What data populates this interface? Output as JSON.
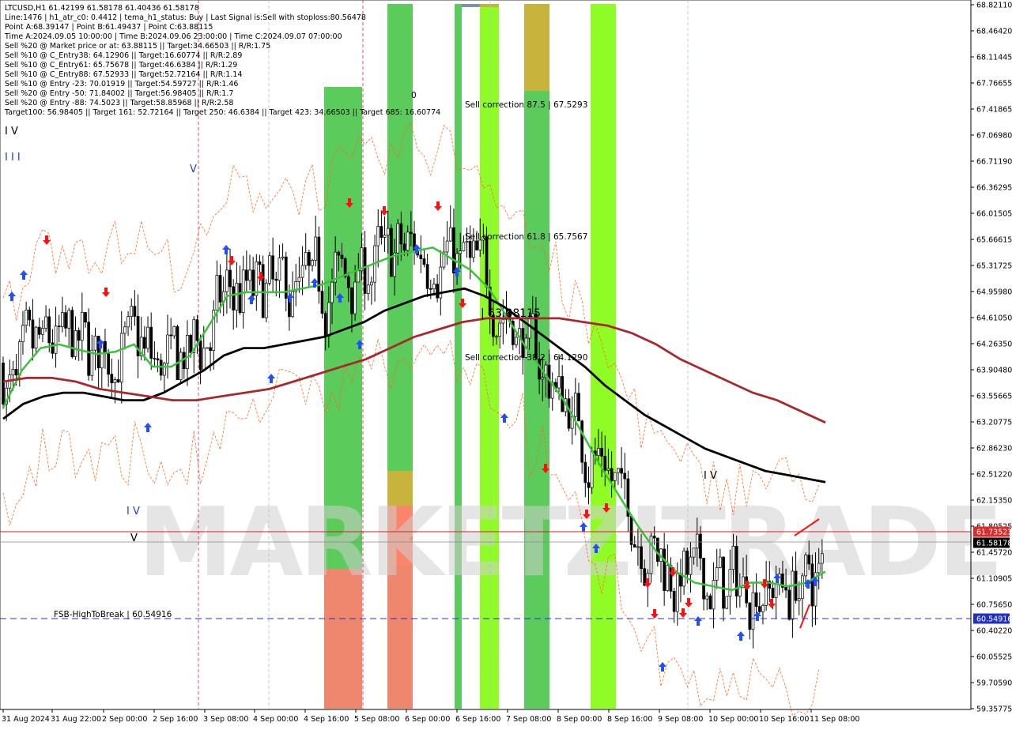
{
  "header": {
    "lines": [
      "LTCUSD,H1  61.42199 61.58178 61.40436 61.58178",
      "Line:1476  |  h1_atr_c0: 0.4412  |  tema_h1_status: Buy  |  Last Signal is:Sell with stoploss:80.56478",
      "Point A:68.39147  |  Point B:61.49437  |  Point C:63.88115",
      "Time A:2024.09.05 10:00:00  |  Time B:2024.09.06 23:00:00  |  Time C:2024.09.07 07:00:00",
      "Sell %20 @ Market price or at: 63.88115  ||  Target:34.66503  ||  R/R:1.75",
      "Sell %10 @ C_Entry38: 64.12906  ||  Target:16.60774  ||  R/R:2.89",
      "Sell %10 @ C_Entry61: 65.75678  ||  Target:46.6384  ||  R/R:1.29",
      "Sell %10 @ C_Entry88: 67.52933  ||  Target:52.72164  ||  R/R:1.14",
      "Sell %10 @ Entry -23: 70.01919  ||  Target:54.59727  ||  R/R:1.46",
      "Sell %20 @ Entry -50: 71.84002  ||  Target:56.98405  ||  R/R:1.7",
      "Sell %20 @ Entry -88: 74.5023  ||  Target:58.85968  ||  R/R:2.58",
      "Target100: 56.98405  ||  Target 161: 52.72164  ||  Target 250: 46.6384  ||  Target 423: 34.66503  ||  Target 685: 16.60774"
    ]
  },
  "waves": {
    "w_iv_top": "I V",
    "w_iii": "I I I",
    "w_v_mid": "V",
    "w_iv_left": "I V",
    "w_v_left": "V",
    "w_iv_right": "I V"
  },
  "annotations": {
    "sell87": "Sell correction 87.5 | 67.5293",
    "sell61": "Sell correction 61.8 | 65.7567",
    "sell38": "Sell correction 38.2 | 64.1290",
    "pointC": "| 63.88115",
    "fsb": "FSB-HighToBreak  |  60.54916",
    "zero": "0"
  },
  "watermark": "MARKETZITRADE",
  "colors": {
    "green_zone": "#3ec23e",
    "lime_zone": "#7cfc00",
    "olive_zone": "#c8b43c",
    "salmon_zone": "#ff8070",
    "ma_green": "#39c439",
    "ma_black": "#000000",
    "ma_red": "#a8282c",
    "bull_arrow": "#1f4fff",
    "bear_arrow": "#ff1010",
    "fsb_line": "#2030c0",
    "red_level": "#d02020"
  },
  "chart_data": {
    "type": "candlestick",
    "symbol": "LTCUSD",
    "timeframe": "H1",
    "ohlc_last": {
      "open": 61.42199,
      "high": 61.58178,
      "low": 61.40436,
      "close": 61.58178
    },
    "y_ticks": [
      "68.82110",
      "68.46420",
      "68.11445",
      "67.76655",
      "67.41865",
      "67.06980",
      "66.71190",
      "66.36295",
      "66.01505",
      "65.66615",
      "65.31725",
      "64.95980",
      "64.61050",
      "64.26350",
      "63.90480",
      "63.55665",
      "63.20775",
      "62.86230",
      "62.51220",
      "62.15350",
      "61.80525",
      "61.45720",
      "61.10905",
      "60.75650",
      "60.40220",
      "60.05525",
      "59.70590",
      "59.35775"
    ],
    "x_ticks": [
      "31 Aug 2024",
      "31 Aug 22:00",
      "2 Sep 00:00",
      "2 Sep 16:00",
      "3 Sep 08:00",
      "4 Sep 00:00",
      "4 Sep 16:00",
      "5 Sep 08:00",
      "6 Sep 00:00",
      "6 Sep 16:00",
      "7 Sep 08:00",
      "8 Sep 00:00",
      "8 Sep 16:00",
      "9 Sep 08:00",
      "10 Sep 00:00",
      "10 Sep 16:00",
      "11 Sep 08:00"
    ],
    "price_tags": [
      {
        "label": "61.73523",
        "value": 61.73523,
        "color": "#e02828"
      },
      {
        "label": "61.58178",
        "value": 61.58178,
        "color": "#000000"
      },
      {
        "label": "60.54916",
        "value": 60.54916,
        "color": "#2030c0"
      }
    ],
    "ylim": [
      59.35775,
      68.8211
    ],
    "zones": [
      {
        "x0": 0.0,
        "x1": 0.045,
        "color": "green"
      },
      {
        "x0": 0.158,
        "x1": 0.188,
        "color": "green"
      },
      {
        "x0": 0.196,
        "x1": 0.213,
        "color": "green"
      },
      {
        "x0": 0.232,
        "x1": 0.245,
        "color": "lime"
      },
      {
        "x0": 0.25,
        "x1": 0.274,
        "color": "green"
      },
      {
        "x0": 0.288,
        "x1": 0.306,
        "color": "green"
      },
      {
        "x0": 0.324,
        "x1": 0.355,
        "color": "lime"
      }
    ],
    "series": [
      {
        "name": "",
        "color": "#39c439",
        "values": [
          63.4,
          63.9,
          64.2,
          64.25,
          64.18,
          64.12,
          64.15,
          64.25,
          63.95,
          63.95,
          64.1,
          64.5,
          64.9,
          64.95,
          64.95,
          64.95,
          65.0,
          65.05,
          65.15,
          65.25,
          65.35,
          65.45,
          65.5,
          65.55,
          65.4,
          65.25,
          65.0,
          64.6,
          64.2,
          63.85,
          63.5,
          63.05,
          62.6,
          62.2,
          61.8,
          61.45,
          61.2,
          61.05,
          61.0,
          60.95,
          61.05,
          61.05,
          61.0,
          61.05,
          61.2
        ]
      },
      {
        "name": "",
        "color": "#000000",
        "values": [
          63.25,
          63.45,
          63.55,
          63.6,
          63.6,
          63.55,
          63.5,
          63.5,
          63.6,
          63.75,
          63.9,
          64.1,
          64.2,
          64.2,
          64.25,
          64.3,
          64.35,
          64.45,
          64.55,
          64.7,
          64.8,
          64.9,
          64.95,
          65.0,
          64.9,
          64.75,
          64.55,
          64.35,
          64.15,
          63.95,
          63.7,
          63.5,
          63.3,
          63.15,
          63.0,
          62.85,
          62.75,
          62.65,
          62.55,
          62.5,
          62.45,
          62.4
        ]
      },
      {
        "name": "",
        "color": "#a8282c",
        "values": [
          63.75,
          63.8,
          63.8,
          63.75,
          63.65,
          63.6,
          63.55,
          63.5,
          63.5,
          63.55,
          63.6,
          63.65,
          63.75,
          63.85,
          63.95,
          64.05,
          64.2,
          64.35,
          64.45,
          64.55,
          64.6,
          64.6,
          64.6,
          64.6,
          64.55,
          64.5,
          64.4,
          64.25,
          64.05,
          63.9,
          63.75,
          63.6,
          63.5,
          63.35,
          63.2
        ]
      }
    ]
  }
}
